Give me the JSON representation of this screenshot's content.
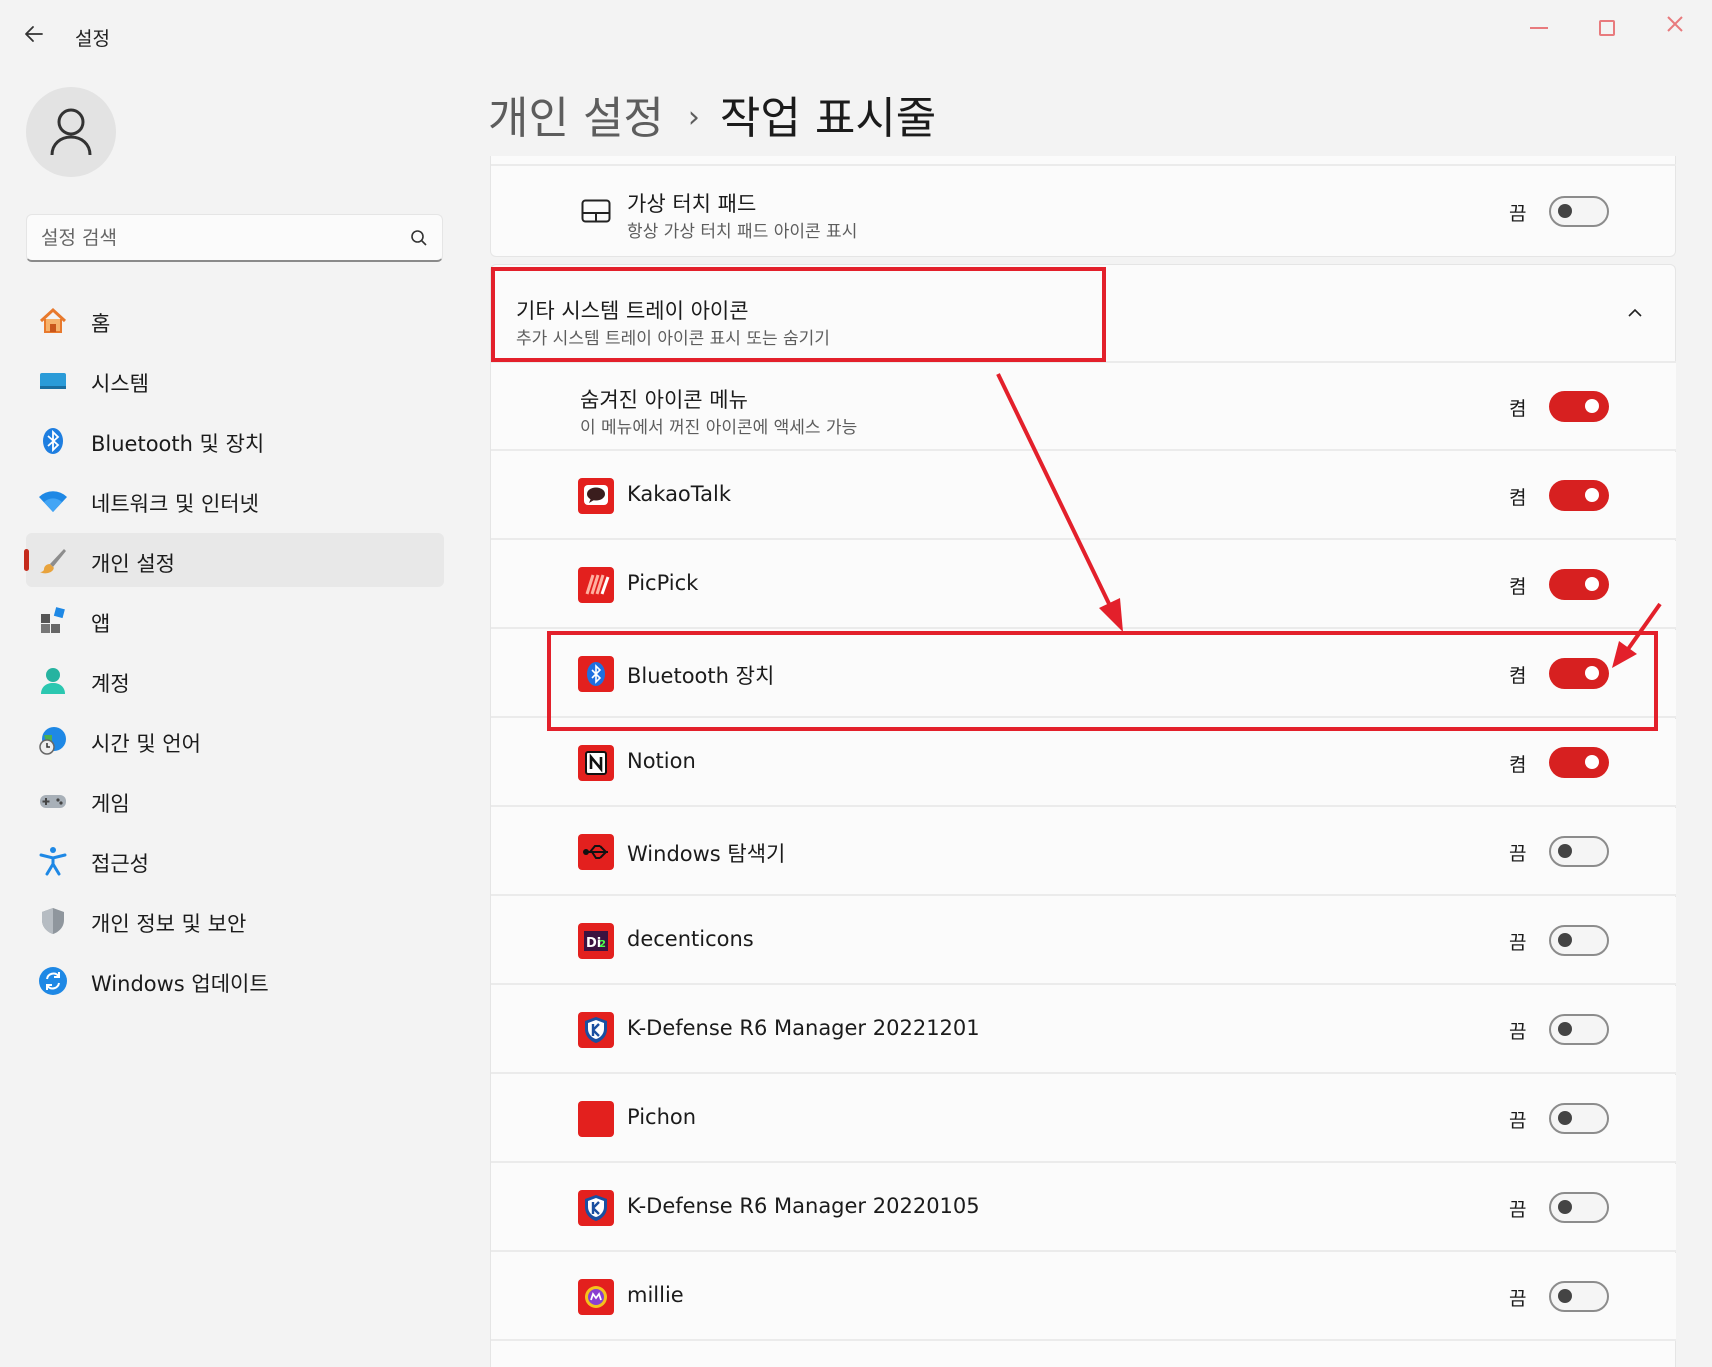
{
  "window": {
    "title": "설정",
    "controls": [
      "minimize",
      "maximize",
      "close"
    ]
  },
  "sidebar": {
    "search_placeholder": "설정 검색",
    "items": [
      {
        "label": "홈",
        "icon": "home-icon"
      },
      {
        "label": "시스템",
        "icon": "system-icon"
      },
      {
        "label": "Bluetooth 및 장치",
        "icon": "bluetooth-icon"
      },
      {
        "label": "네트워크 및 인터넷",
        "icon": "wifi-icon"
      },
      {
        "label": "개인 설정",
        "icon": "brush-icon",
        "active": true
      },
      {
        "label": "앱",
        "icon": "apps-icon"
      },
      {
        "label": "계정",
        "icon": "account-icon"
      },
      {
        "label": "시간 및 언어",
        "icon": "time-language-icon"
      },
      {
        "label": "게임",
        "icon": "gamepad-icon"
      },
      {
        "label": "접근성",
        "icon": "accessibility-icon"
      },
      {
        "label": "개인 정보 및 보안",
        "icon": "shield-icon"
      },
      {
        "label": "Windows 업데이트",
        "icon": "windows-update-icon"
      }
    ]
  },
  "header": {
    "parent": "개인 설정",
    "separator": "›",
    "current": "작업 표시줄"
  },
  "touchpad": {
    "title": "가상 터치 패드",
    "desc": "항상 가상 터치 패드 아이콘 표시",
    "state": "끔",
    "on": false
  },
  "tray_section": {
    "title": "기타 시스템 트레이 아이콘",
    "desc": "추가 시스템 트레이 아이콘 표시 또는 숨기기",
    "expanded": true
  },
  "hidden_menu": {
    "title": "숨겨진 아이콘 메뉴",
    "desc": "이 메뉴에서 꺼진 아이콘에 액세스 가능",
    "state": "켬",
    "on": true
  },
  "apps": [
    {
      "name": "KakaoTalk",
      "state": "켬",
      "on": true,
      "icon": "kakaotalk-icon"
    },
    {
      "name": "PicPick",
      "state": "켬",
      "on": true,
      "icon": "picpick-icon"
    },
    {
      "name": "Bluetooth 장치",
      "state": "켬",
      "on": true,
      "icon": "bluetooth-device-icon"
    },
    {
      "name": "Notion",
      "state": "켬",
      "on": true,
      "icon": "notion-icon"
    },
    {
      "name": "Windows 탐색기",
      "state": "끔",
      "on": false,
      "icon": "usb-icon"
    },
    {
      "name": "decenticons",
      "state": "끔",
      "on": false,
      "icon": "decenticons-icon"
    },
    {
      "name": "K-Defense R6 Manager 20221201",
      "state": "끔",
      "on": false,
      "icon": "kdefense-icon"
    },
    {
      "name": "Pichon",
      "state": "끔",
      "on": false,
      "icon": "pichon-icon"
    },
    {
      "name": "K-Defense R6 Manager 20220105",
      "state": "끔",
      "on": false,
      "icon": "kdefense-icon"
    },
    {
      "name": "millie",
      "state": "끔",
      "on": false,
      "icon": "millie-icon"
    }
  ],
  "colors": {
    "accent": "#d72020",
    "annotation": "#e3202b"
  }
}
